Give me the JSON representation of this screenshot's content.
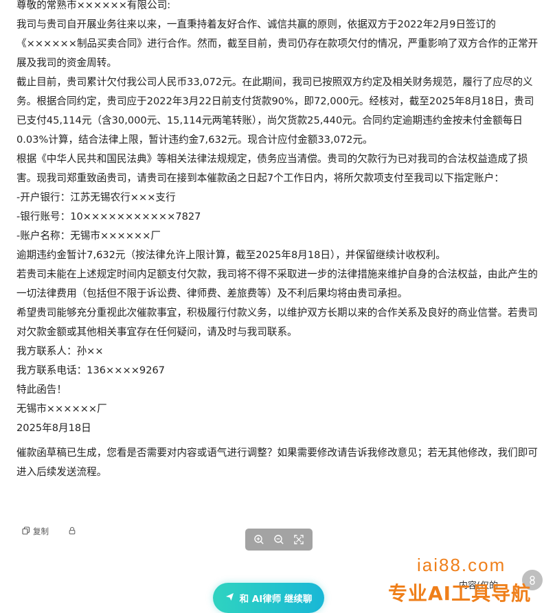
{
  "letter": {
    "greeting": "尊敬的常熟市××××××有限公司:",
    "paragraphs": [
      "我司与贵司自开展业务往来以来，一直秉持着友好合作、诚信共赢的原则，依据双方于2022年2月9日签订的《××××××制品买卖合同》进行合作。然而，截至目前，贵司仍存在款项欠付的情况，严重影响了双方合作的正常开展及我司的资金周转。",
      "截止目前，贵司累计欠付我公司人民币33,072元。在此期间，我司已按照双方约定及相关财务规范，履行了应尽的义务。根据合同约定，贵司应于2022年3月22日前支付货款90%，即72,000元。经核对，截至2025年8月18日，贵司已支付45,114元（含30,000元、15,114元两笔转账），尚欠货款25,440元。合同约定逾期违约金按未付金额每日0.03%计算，结合法律上限，暂计违约金7,632元。现合计应付金额33,072元。",
      "根据《中华人民共和国民法典》等相关法律法规规定，债务应当清偿。贵司的欠款行为已对我司的合法权益造成了损害。现我司郑重致函贵司，请贵司在接到本催款函之日起7个工作日内，将所欠款项支付至我司以下指定账户：",
      "-开户银行：江苏无锡农行×××支行",
      "-银行账号：10×××××××××××7827",
      "-账户名称：无锡市××××××厂",
      "逾期违约金暂计7,632元（按法律允许上限计算，截至2025年8月18日），并保留继续计收权利。",
      "若贵司未能在上述规定时间内足额支付欠款，我司将不得不采取进一步的法律措施来维护自身的合法权益，由此产生的一切法律费用（包括但不限于诉讼费、律师费、差旅费等）及不利后果均将由贵司承担。",
      "希望贵司能够充分重视此次催款事宜，积极履行付款义务，以维护双方长期以来的合作关系及良好的商业信誉。若贵司对欠款金额或其他相关事宜存在任何疑问，请及时与我司联系。",
      "我方联系人：孙××",
      "我方联系电话：136××××9267",
      "特此函告！",
      "无锡市××××××厂",
      "2025年8月18日"
    ]
  },
  "assistant_note": "催款函草稿已生成，您看是否需要对内容或语气进行调整？如果需要修改请告诉我修改意见；若无其他修改，我们即可进入后续发送流程。",
  "actions": {
    "copy_label": "复制",
    "copy_icon": "copy-icon",
    "lock_icon": "lock-icon"
  },
  "zoom_toolbar": {
    "icons": [
      "zoom-in-icon",
      "zoom-out-icon",
      "fit-screen-icon"
    ]
  },
  "continue_button": {
    "label": "和 AI律师 继续聊",
    "icon": "send-icon"
  },
  "side_panel": {
    "partial_text": "内容(仅的"
  },
  "watermark": {
    "domain": "iai88.com",
    "slogan": "专业AI工具导航"
  },
  "colors": {
    "accent_start": "#2fd3c0",
    "accent_end": "#19b7d6",
    "watermark": "#ef7f1a",
    "toolbar_bg": "#a3a3a3"
  }
}
